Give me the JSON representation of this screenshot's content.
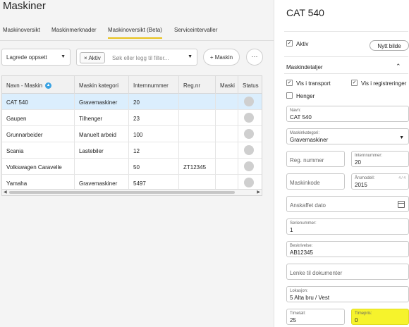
{
  "header": {
    "title": "Maskiner"
  },
  "tabs": [
    {
      "label": "Maskinoversikt",
      "active": false
    },
    {
      "label": "Maskinmerknader",
      "active": false
    },
    {
      "label": "Maskinoversikt (Beta)",
      "active": true
    },
    {
      "label": "Serviceintervaller",
      "active": false
    }
  ],
  "toolbar": {
    "saved_layout": "Lagrede oppsett",
    "filter_chip": "× Aktiv",
    "filter_placeholder": "Søk eller legg til filter...",
    "add_button": "+ Maskin",
    "more_button": "···"
  },
  "grid": {
    "columns": [
      "Navn - Maskin",
      "Maskin kategori",
      "Internnummer",
      "Reg.nr",
      "Maski",
      "Status"
    ],
    "rows": [
      {
        "name": "CAT 540",
        "category": "Gravemaskiner",
        "internal": "20",
        "reg": "",
        "selected": true
      },
      {
        "name": "Gaupen",
        "category": "Tilhenger",
        "internal": "23",
        "reg": "",
        "selected": false
      },
      {
        "name": "Grunnarbeider",
        "category": "Manuelt arbeid",
        "internal": "100",
        "reg": "",
        "selected": false
      },
      {
        "name": "Scania",
        "category": "Lastebiler",
        "internal": "12",
        "reg": "",
        "selected": false
      },
      {
        "name": "Volkswagen Caravelle",
        "category": "",
        "internal": "50",
        "reg": "ZT12345",
        "selected": false
      },
      {
        "name": "Yamaha",
        "category": "Gravemaskiner",
        "internal": "5497",
        "reg": "",
        "selected": false
      }
    ]
  },
  "detail": {
    "title": "CAT 540",
    "active_label": "Aktiv",
    "new_image_button": "Nytt bilde",
    "section_title": "Maskindetaljer",
    "vis_transport": "Vis i transport",
    "vis_registreringer": "Vis i registreringer",
    "henger": "Henger",
    "navn": {
      "label": "Navn:",
      "value": "CAT 540"
    },
    "kategori": {
      "label": "Maskinkategori:",
      "value": "Gravemaskiner"
    },
    "reg_nummer": {
      "placeholder": "Reg. nummer"
    },
    "internnummer": {
      "label": "Internnummer:",
      "value": "20"
    },
    "maskinkode": {
      "placeholder": "Maskinkode"
    },
    "arsmodell": {
      "label": "Årsmodell:",
      "value": "2015",
      "counter": "4 / 4"
    },
    "anskaffet": {
      "placeholder": "Anskaffet dato"
    },
    "serienummer": {
      "label": "Serienummer:",
      "value": "1"
    },
    "beskrivelse": {
      "label": "Beskrivelse:",
      "value": "AB12345"
    },
    "lenke": {
      "placeholder": "Lenke til dokumenter"
    },
    "lokasjon": {
      "label": "Lokasjon:",
      "value": "5 Alta bru / Vest"
    },
    "timetall": {
      "label": "Timetall:",
      "value": "25"
    },
    "timepris": {
      "label": "Timepris:",
      "value": "0"
    }
  }
}
